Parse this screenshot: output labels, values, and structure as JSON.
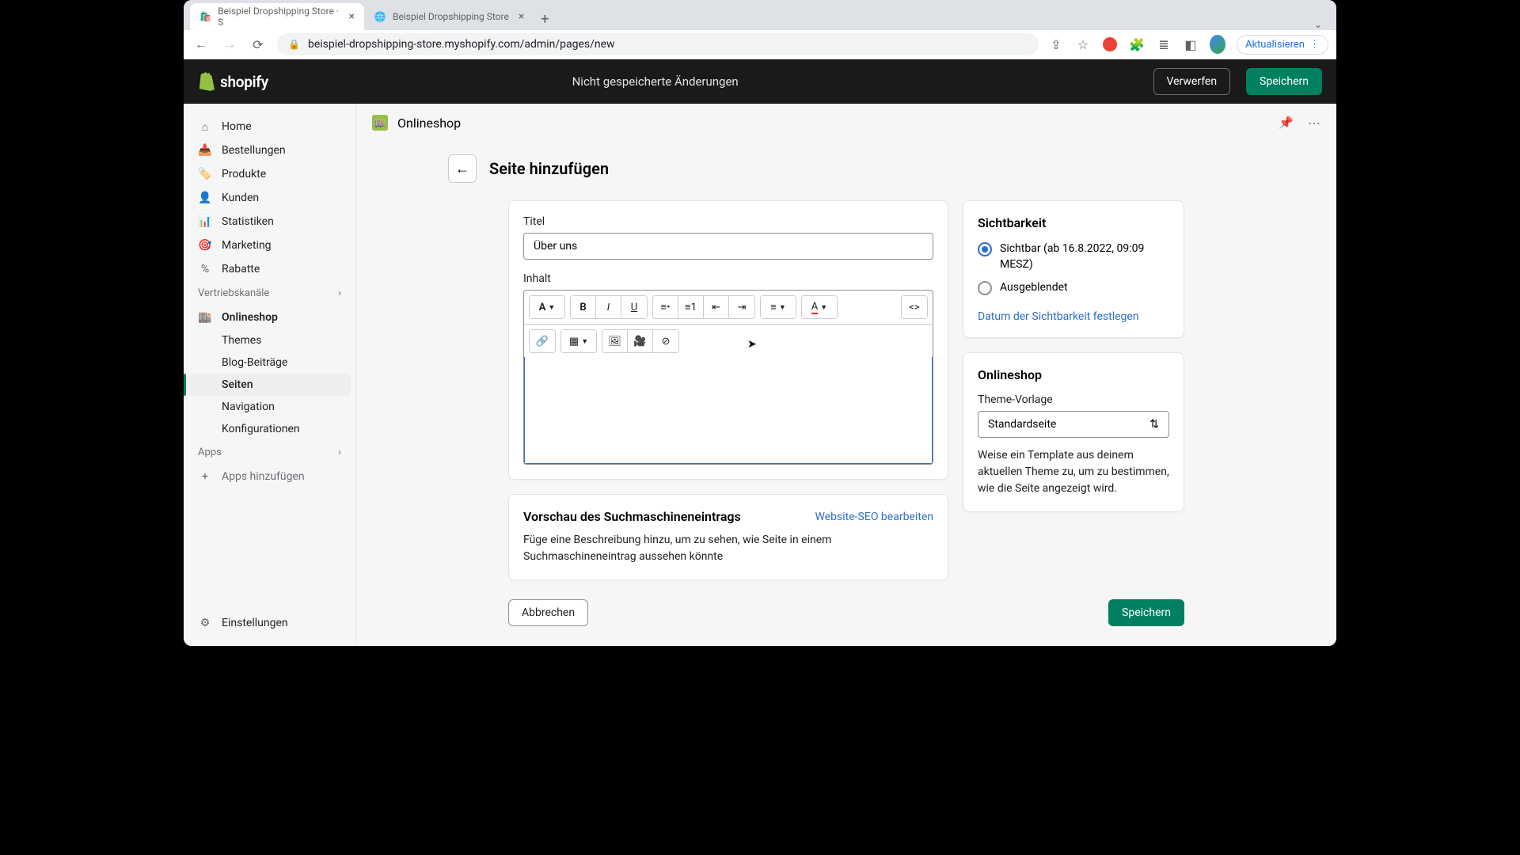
{
  "browser": {
    "tabs": [
      {
        "title": "Beispiel Dropshipping Store · S",
        "favicon": "🛍️",
        "active": true
      },
      {
        "title": "Beispiel Dropshipping Store",
        "favicon": "🌐",
        "active": false
      }
    ],
    "url": "beispiel-dropshipping-store.myshopify.com/admin/pages/new",
    "update_label": "Aktualisieren"
  },
  "appbar": {
    "logo": "shopify",
    "message": "Nicht gespeicherte Änderungen",
    "discard": "Verwerfen",
    "save": "Speichern"
  },
  "sidebar": {
    "home": "Home",
    "orders": "Bestellungen",
    "products": "Produkte",
    "customers": "Kunden",
    "analytics": "Statistiken",
    "marketing": "Marketing",
    "discounts": "Rabatte",
    "channels_title": "Vertriebskanäle",
    "onlinestore": "Onlineshop",
    "themes": "Themes",
    "blog": "Blog-Beiträge",
    "pages": "Seiten",
    "navigation": "Navigation",
    "prefs": "Konfigurationen",
    "apps_title": "Apps",
    "apps_add": "Apps hinzufügen",
    "settings": "Einstellungen"
  },
  "page": {
    "channel": "Onlineshop",
    "title": "Seite hinzufügen",
    "form": {
      "title_label": "Titel",
      "title_value": "Über uns",
      "content_label": "Inhalt"
    },
    "seo": {
      "heading": "Vorschau des Suchmaschineneintrags",
      "edit_link": "Website-SEO bearbeiten",
      "description": "Füge eine Beschreibung hinzu, um zu sehen, wie Seite in einem Suchmaschineneintrag aussehen könnte"
    },
    "visibility": {
      "heading": "Sichtbarkeit",
      "visible": "Sichtbar (ab 16.8.2022, 09:09 MESZ)",
      "hidden": "Ausgeblendet",
      "set_date": "Datum der Sichtbarkeit festlegen"
    },
    "template": {
      "heading": "Onlineshop",
      "label": "Theme-Vorlage",
      "value": "Standardseite",
      "help": "Weise ein Template aus deinem aktuellen Theme zu, um zu bestimmen, wie die Seite angezeigt wird."
    },
    "actions": {
      "cancel": "Abbrechen",
      "save": "Speichern"
    }
  }
}
